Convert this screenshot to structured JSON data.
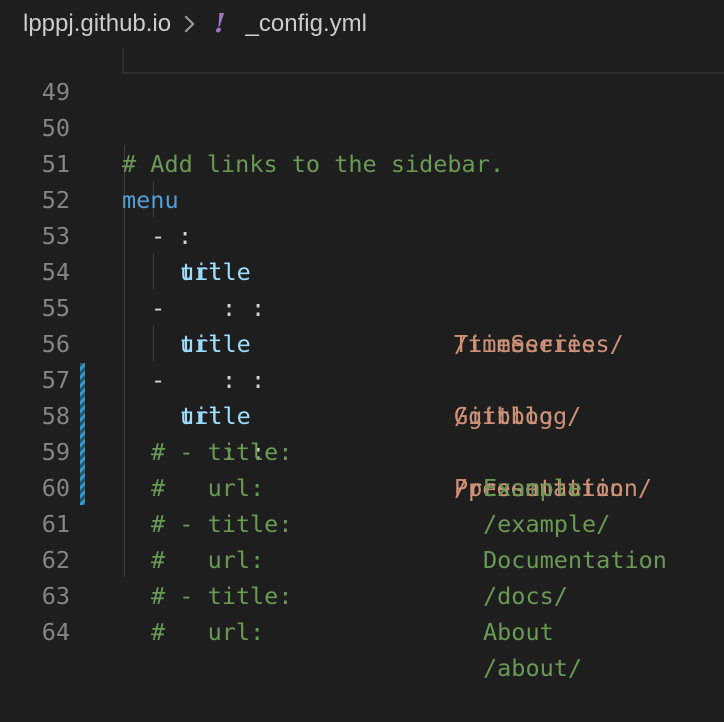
{
  "breadcrumb": {
    "folder": "lpppj.github.io",
    "file": "_config.yml",
    "file_icon": "yaml-exclamation-icon"
  },
  "lines": [
    {
      "num": "49"
    },
    {
      "num": "50",
      "comment": "# Add links to the sidebar."
    },
    {
      "num": "51",
      "key": "menu",
      "colon": ":"
    },
    {
      "num": "52",
      "dash": "-",
      "key": "title",
      "colon": ":",
      "value": "TimeSeries"
    },
    {
      "num": "53",
      "key": "url",
      "colon": ":",
      "value": "/timeseries/"
    },
    {
      "num": "54",
      "dash": "-",
      "key": "title",
      "colon": ":",
      "value": "Gitblog"
    },
    {
      "num": "55",
      "key": "url",
      "colon": ":",
      "value": "/gitblog/"
    },
    {
      "num": "56",
      "dash": "-",
      "key": "title",
      "colon": ":",
      "value": "Presentation"
    },
    {
      "num": "57",
      "key": "url",
      "colon": ":",
      "value": "/presentation/"
    },
    {
      "num": "58",
      "comment_key": "# - title:",
      "comment_value": "Example"
    },
    {
      "num": "59",
      "comment_key": "#   url:",
      "comment_value": "/example/"
    },
    {
      "num": "60",
      "comment_key": "# - title:",
      "comment_value": "Documentation"
    },
    {
      "num": "61",
      "comment_key": "#   url:",
      "comment_value": "/docs/"
    },
    {
      "num": "62",
      "comment_key": "# - title:",
      "comment_value": "About"
    },
    {
      "num": "63",
      "comment_key": "#   url:",
      "comment_value": "/about/"
    },
    {
      "num": "64"
    }
  ],
  "colors": {
    "background": "#1e1e1e",
    "comment": "#6a9955",
    "key": "#569cd6",
    "string": "#ce9178",
    "line_number": "#858585",
    "modified_gutter": "#3a9ad0"
  }
}
